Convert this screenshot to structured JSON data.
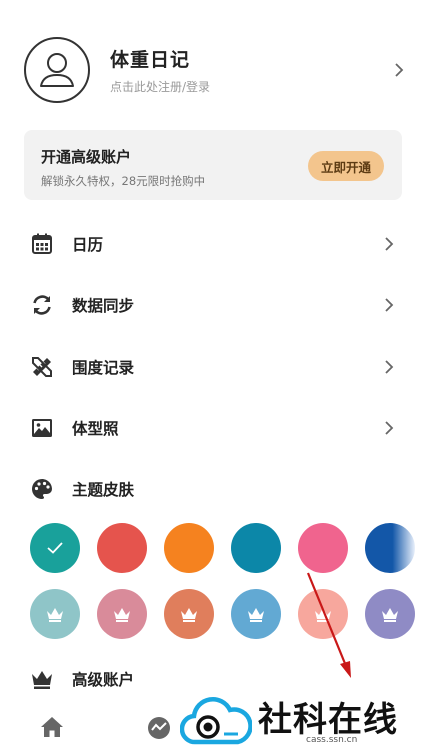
{
  "profile": {
    "app_name": "体重日记",
    "login_hint": "点击此处注册/登录"
  },
  "premium": {
    "title": "开通高级账户",
    "subtitle": "解锁永久特权，28元限时抢购中",
    "button": "立即开通"
  },
  "menu": [
    {
      "label": "日历",
      "icon": "calendar-icon"
    },
    {
      "label": "数据同步",
      "icon": "sync-icon"
    },
    {
      "label": "围度记录",
      "icon": "ruler-pencil-icon"
    },
    {
      "label": "体型照",
      "icon": "image-icon"
    },
    {
      "label": "主题皮肤",
      "icon": "palette-icon"
    },
    {
      "label": "高级账户",
      "icon": "crown-icon"
    }
  ],
  "theme_colors": {
    "row1": [
      "#19a19b",
      "#e5544d",
      "#f5821f",
      "#0c87a8",
      "#f0648e",
      "#1357a8"
    ],
    "row2": [
      "#8fc5c8",
      "#d98b9a",
      "#e07e5c",
      "#62a9d3",
      "#f7a79d",
      "#8f8bc5"
    ],
    "selected": "#19a19b"
  },
  "watermark": {
    "text": "社科在线",
    "url": "cass.ssn.cn"
  },
  "tabs": [
    "home-icon",
    "chart-icon"
  ]
}
